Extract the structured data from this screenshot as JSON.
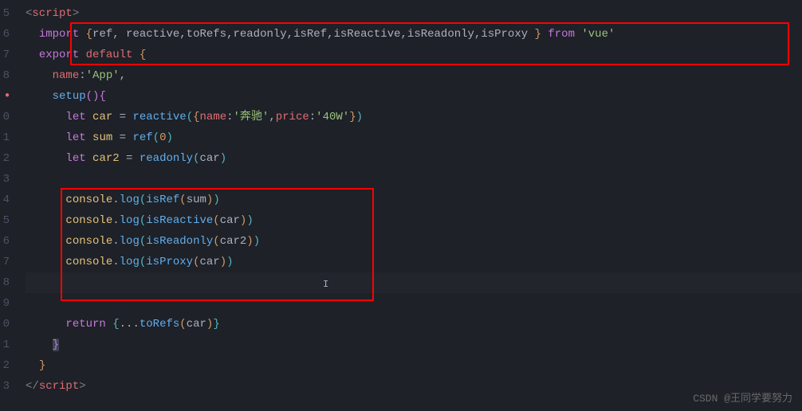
{
  "lineNumbers": [
    "5",
    "6",
    "7",
    "8",
    "",
    "0",
    "1",
    "2",
    "3",
    "4",
    "5",
    "6",
    "7",
    "8",
    "9",
    "0",
    "1",
    "2",
    "3"
  ],
  "errorLineIndex": 4,
  "code": {
    "l0": {
      "open": "<",
      "tag": "script",
      "close": ">"
    },
    "l1": {
      "import": "import",
      "lb": "{",
      "items": "ref, reactive,toRefs,readonly,isRef,isReactive,isReadonly,isProxy ",
      "rb": "}",
      "from": "from",
      "str": "'vue'"
    },
    "l2": {
      "export": "export",
      "default": "default",
      "lb": "{"
    },
    "l3": {
      "prop": "name",
      "colon": ":",
      "str": "'App'",
      "comma": ","
    },
    "l4": {
      "method": "setup",
      "paren": "()",
      "lb": "{"
    },
    "l5": {
      "let": "let",
      "var": "car",
      "eq": " = ",
      "fn": "reactive",
      "lp": "(",
      "lb": "{",
      "p1": "name",
      "c1": ":",
      "s1": "'奔驰'",
      "cm": ",",
      "p2": "price",
      "c2": ":",
      "s2": "'40W'",
      "rb": "}",
      "rp": ")"
    },
    "l6": {
      "let": "let",
      "var": "sum",
      "eq": " = ",
      "fn": "ref",
      "lp": "(",
      "num": "0",
      "rp": ")"
    },
    "l7": {
      "let": "let",
      "var": "car2",
      "eq": " = ",
      "fn": "readonly",
      "lp": "(",
      "arg": "car",
      "rp": ")"
    },
    "l9": {
      "obj": "console",
      "dot": ".",
      "m": "log",
      "lp": "(",
      "fn": "isRef",
      "lp2": "(",
      "arg": "sum",
      "rp2": ")",
      "rp": ")"
    },
    "l10": {
      "obj": "console",
      "dot": ".",
      "m": "log",
      "lp": "(",
      "fn": "isReactive",
      "lp2": "(",
      "arg": "car",
      "rp2": ")",
      "rp": ")"
    },
    "l11": {
      "obj": "console",
      "dot": ".",
      "m": "log",
      "lp": "(",
      "fn": "isReadonly",
      "lp2": "(",
      "arg": "car2",
      "rp2": ")",
      "rp": ")"
    },
    "l12": {
      "obj": "console",
      "dot": ".",
      "m": "log",
      "lp": "(",
      "fn": "isProxy",
      "lp2": "(",
      "arg": "car",
      "rp2": ")",
      "rp": ")"
    },
    "l15": {
      "ret": "return",
      "lb": "{",
      "spread": "...",
      "fn": "toRefs",
      "lp": "(",
      "arg": "car",
      "rp": ")",
      "rb": "}"
    },
    "l16": {
      "rb": "}"
    },
    "l17": {
      "rb": "}"
    },
    "l18": {
      "open": "</",
      "tag": "script",
      "close": ">"
    }
  },
  "watermark": "CSDN @王同学要努力"
}
